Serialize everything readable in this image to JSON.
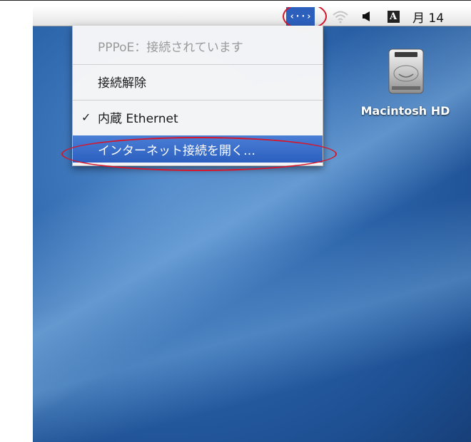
{
  "menubar": {
    "ppp_icon_glyph": "‹··›",
    "wifi_icon": "wifi-icon",
    "volume_icon": "speaker-icon",
    "ime_label": "A",
    "clock": "月 14"
  },
  "menu": {
    "status": "PPPoE：接続されています",
    "disconnect": "接続解除",
    "ethernet_check": "✓",
    "ethernet": "内蔵 Ethernet",
    "open_connect": "インターネット接続を開く…"
  },
  "desktop": {
    "hd_label": "Macintosh HD"
  },
  "colors": {
    "highlight": "#2c5fbf",
    "annotation": "#d6162b"
  }
}
